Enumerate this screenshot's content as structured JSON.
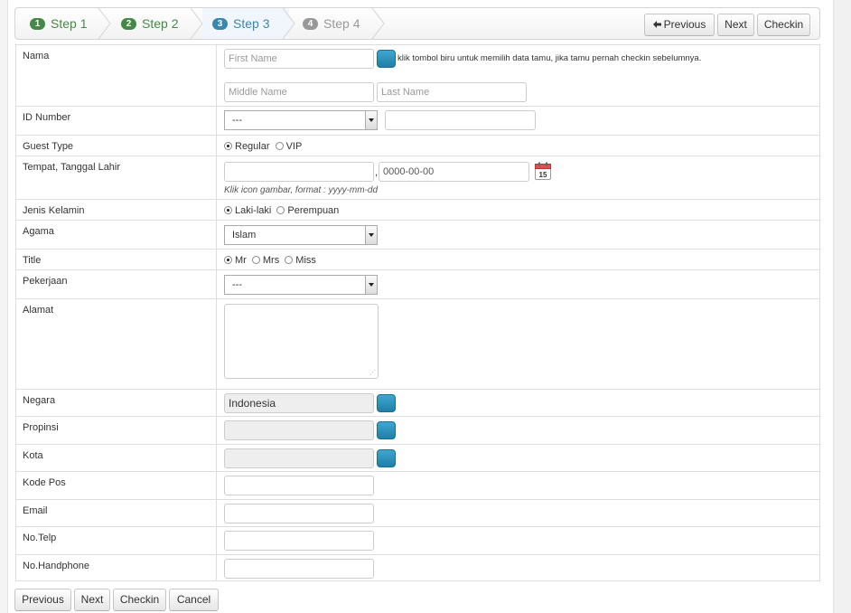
{
  "wizard": {
    "steps": [
      {
        "num": "1",
        "label": "Step 1",
        "state": "done"
      },
      {
        "num": "2",
        "label": "Step 2",
        "state": "done"
      },
      {
        "num": "3",
        "label": "Step 3",
        "state": "active"
      },
      {
        "num": "4",
        "label": "Step 4",
        "state": "pending"
      }
    ],
    "previous_label": "Previous",
    "previous_icon": "arrow-left-icon",
    "next_label": "Next",
    "checkin_label": "Checkin"
  },
  "form": {
    "nama": {
      "label": "Nama",
      "first_name_placeholder": "First Name",
      "middle_name_placeholder": "Middle Name",
      "last_name_placeholder": "Last Name",
      "hint": "klik tombol biru untuk memilih data tamu, jika tamu pernah checkin sebelumnya."
    },
    "id_number": {
      "label": "ID Number",
      "type_selected": "---",
      "value": ""
    },
    "guest_type": {
      "label": "Guest Type",
      "options": [
        "Regular",
        "VIP"
      ],
      "selected": "Regular"
    },
    "birth": {
      "label": "Tempat, Tanggal Lahir",
      "separator": ",",
      "date_value": "0000-00-00",
      "calendar_day": "15",
      "hint": "Klik icon gambar, format : yyyy-mm-dd"
    },
    "gender": {
      "label": "Jenis Kelamin",
      "options": [
        "Laki-laki",
        "Perempuan"
      ],
      "selected": "Laki-laki"
    },
    "agama": {
      "label": "Agama",
      "selected": "Islam"
    },
    "title": {
      "label": "Title",
      "options": [
        "Mr",
        "Mrs",
        "Miss"
      ],
      "selected": "Mr"
    },
    "pekerjaan": {
      "label": "Pekerjaan",
      "selected": "---"
    },
    "alamat": {
      "label": "Alamat"
    },
    "negara": {
      "label": "Negara",
      "value": "Indonesia"
    },
    "propinsi": {
      "label": "Propinsi",
      "value": ""
    },
    "kota": {
      "label": "Kota",
      "value": ""
    },
    "kode_pos": {
      "label": "Kode Pos"
    },
    "email": {
      "label": "Email"
    },
    "no_telp": {
      "label": "No.Telp"
    },
    "no_handphone": {
      "label": "No.Handphone"
    }
  },
  "footer": {
    "previous_label": "Previous",
    "next_label": "Next",
    "checkin_label": "Checkin",
    "cancel_label": "Cancel"
  },
  "colors": {
    "step_done": "#468847",
    "step_active": "#3a87ad",
    "step_pending": "#999999",
    "lookup_button": "#2a8fbd"
  }
}
